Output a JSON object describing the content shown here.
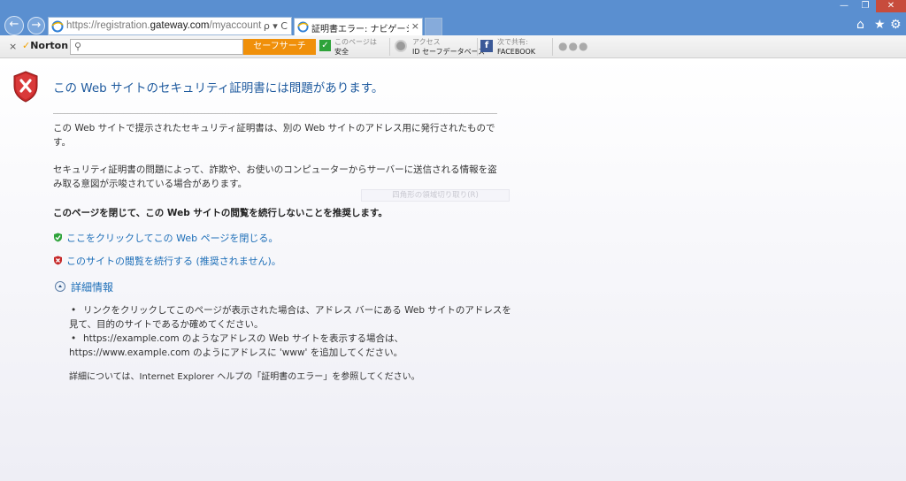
{
  "browser": {
    "url_prefix": "https://registration.",
    "url_domain": "gateway.com",
    "url_path": "/myaccount",
    "address_tools": "ρ ▾ C",
    "tab_title": "証明書エラー: ナビゲーション...",
    "tab_close": "×",
    "back": "←",
    "forward": "→",
    "win_min": "—",
    "win_max": "❐",
    "win_close": "✕",
    "home": "⌂",
    "favorites": "★",
    "settings": "⚙"
  },
  "norton": {
    "close": "×",
    "logo_check": "✓",
    "logo_text": "Norton",
    "search_placeholder": "",
    "search_button": "セーフサーチ",
    "safe_line1": "このページは",
    "safe_line2": "安全",
    "id_line1": "アクセス",
    "id_line2": "ID セーフデータベース",
    "fb_letter": "f",
    "fb_line1": "次で共有:",
    "fb_line2": "FACEBOOK",
    "more_dots": "●●●"
  },
  "page": {
    "title": "この Web サイトのセキュリティ証明書には問題があります。",
    "para1": "この Web サイトで提示されたセキュリティ証明書は、別の Web サイトのアドレス用に発行されたものです。",
    "para2": "セキュリティ証明書の問題によって、詐欺や、お使いのコンピューターからサーバーに送信される情報を盗み取る意図が示唆されている場合があります。",
    "recommend": "このページを閉じて、この Web サイトの閲覧を続行しないことを推奨します。",
    "ghost_text": "四角形の領域切り取り(R)",
    "link_close": "ここをクリックしてこの Web ページを閉じる。",
    "link_continue": "このサイトの閲覧を続行する (推奨されません)。",
    "more_info": "詳細情報",
    "bullet1": "リンクをクリックしてこのページが表示された場合は、アドレス バーにある Web サイトのアドレスを見て、目的のサイトであるか確めてください。",
    "bullet2": "https://example.com のようなアドレスの Web サイトを表示する場合は、https://www.example.com のようにアドレスに 'www' を追加してください。",
    "footer": "詳細については、Internet Explorer ヘルプの「証明書のエラー」を参照してください。"
  },
  "colors": {
    "titlebar": "#5a8fd0",
    "link": "#1e6fb8",
    "title_text": "#1e5a9e",
    "norton_button": "#f0900a",
    "error_red": "#c62828",
    "safe_green": "#2ea33a"
  },
  "icons": {
    "shield": "error-shield-icon",
    "green_shield": "green-shield-check-icon",
    "red_shield": "red-shield-x-icon",
    "expand": "collapse-chevron-icon"
  }
}
